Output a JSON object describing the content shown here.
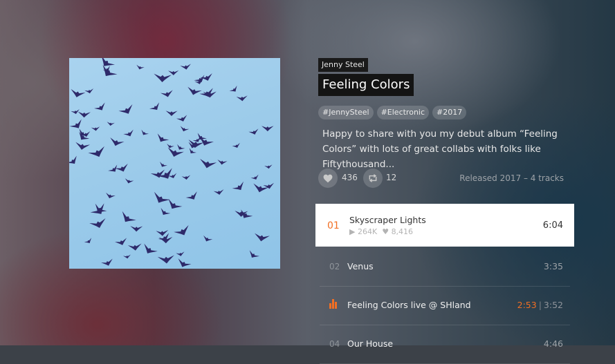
{
  "album": {
    "artist": "Jenny Steel",
    "title": "Feeling Colors",
    "tags": [
      "#JennySteel",
      "#Electronic",
      "#2017"
    ],
    "description": "Happy to share with you my debut album “Feeling Colors” with lots of great collabs with folks like Fiftythousand...",
    "likes": "436",
    "reposts": "12",
    "release_info": "Released 2017 – 4 tracks"
  },
  "tracks": [
    {
      "num": "01",
      "title": "Skyscraper Lights",
      "plays": "264K",
      "likes": "8,416",
      "duration": "6:04"
    },
    {
      "num": "02",
      "title": "Venus",
      "duration": "3:35"
    },
    {
      "num": "03",
      "title": "Feeling Colors live @ SHland",
      "position": "2:53",
      "separator": "|",
      "duration": "3:52"
    },
    {
      "num": "04",
      "title": "Our House",
      "duration": "4:46"
    }
  ],
  "icons": {
    "like": "heart-icon",
    "repost": "repost-icon",
    "play": "play-icon",
    "now_playing": "equalizer-icon"
  },
  "colors": {
    "accent": "#f26f23",
    "selected_row": "#ffffff",
    "label_bg": "#141414"
  }
}
